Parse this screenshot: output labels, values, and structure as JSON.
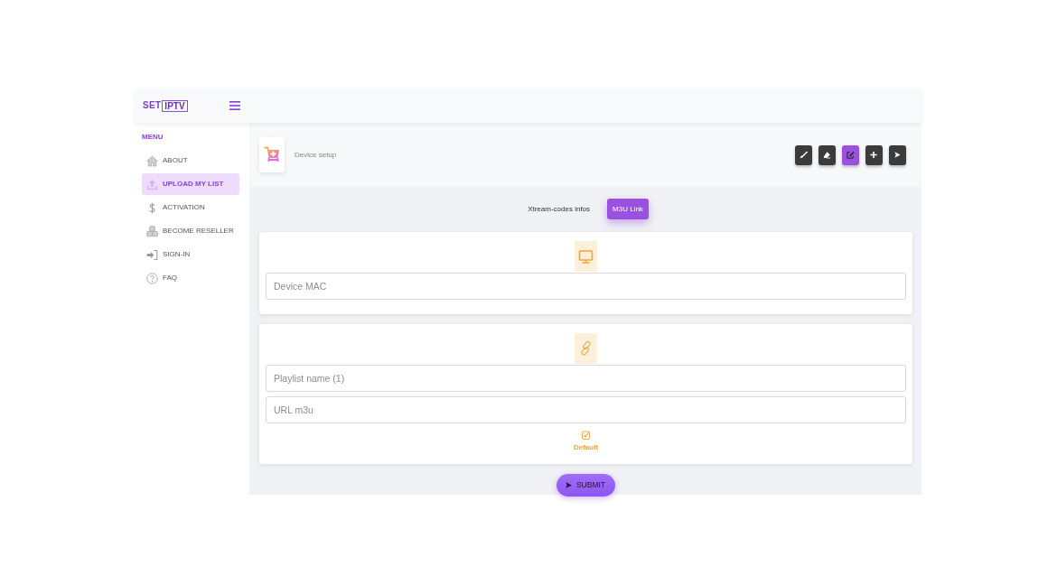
{
  "header": {
    "logo": {
      "text": "SET",
      "framed_text": "IPTV"
    }
  },
  "sidebar": {
    "heading": "MENU",
    "items": [
      {
        "label": "ABOUT",
        "selected": false
      },
      {
        "label": "UPLOAD MY LIST",
        "selected": true
      },
      {
        "label": "ACTIVATION",
        "selected": false
      },
      {
        "label": "BECOME RESELLER",
        "selected": false
      },
      {
        "label": "SIGN-IN",
        "selected": false
      },
      {
        "label": "FAQ",
        "selected": false
      }
    ]
  },
  "page_header": {
    "title": "Device setup",
    "toolbar": [
      {
        "selected": false
      },
      {
        "selected": false
      },
      {
        "selected": true
      },
      {
        "selected": false
      },
      {
        "selected": false
      }
    ]
  },
  "tabs": [
    {
      "label": "Xtream-codes infos",
      "selected": false
    },
    {
      "label": "M3U Link",
      "selected": true
    }
  ],
  "device_card": {
    "field": {
      "placeholder": "Device MAC"
    }
  },
  "playlist_card": {
    "fields": [
      {
        "placeholder": "Playlist name (1)"
      },
      {
        "placeholder": "URL m3u"
      }
    ],
    "default_option": {
      "label": "Default",
      "checked": true
    }
  },
  "submit_button": {
    "label": "SUBMIT"
  }
}
